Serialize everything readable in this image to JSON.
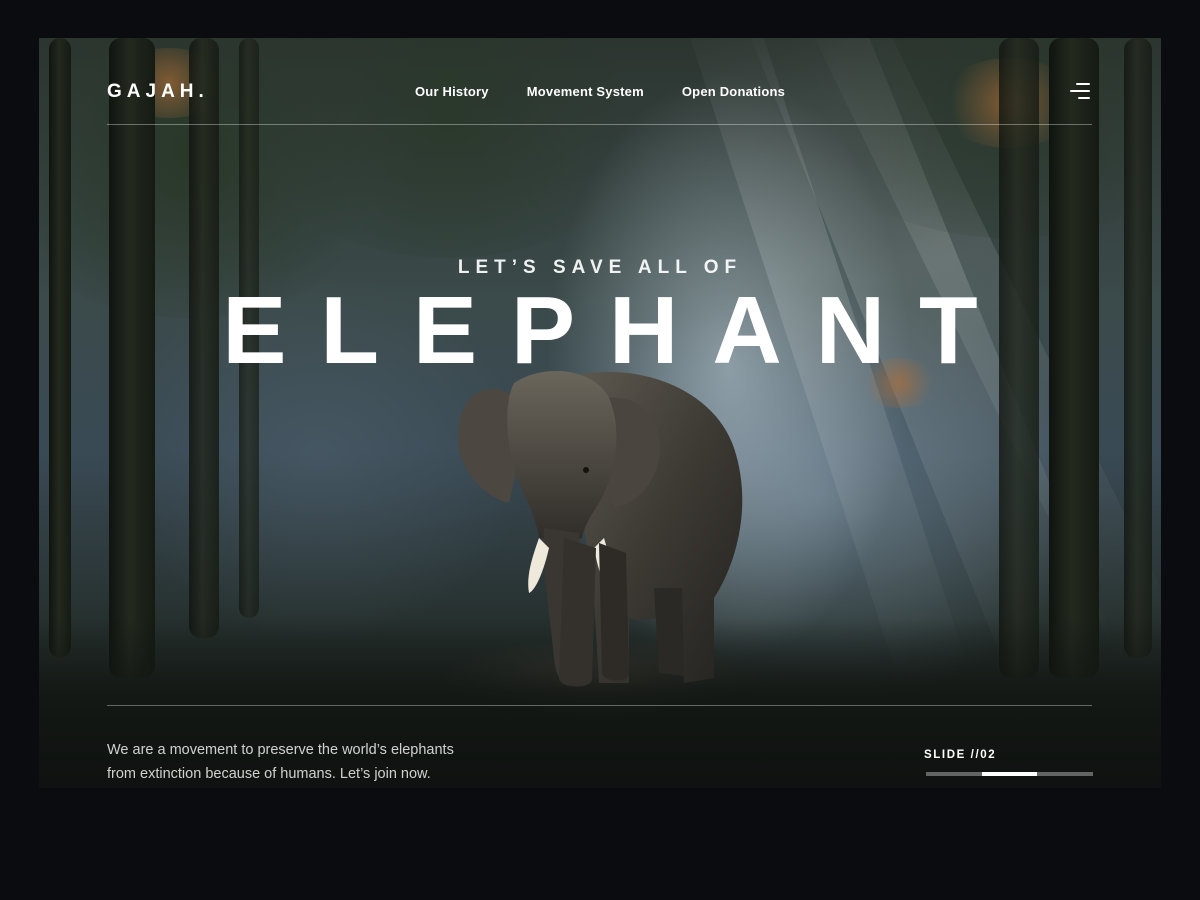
{
  "brand": {
    "logo": "GAJAH."
  },
  "nav": {
    "items": [
      {
        "label": "Our History"
      },
      {
        "label": "Movement System"
      },
      {
        "label": "Open Donations"
      }
    ],
    "menu_icon": "hamburger-menu-icon"
  },
  "hero": {
    "kicker": "LET’S SAVE ALL OF",
    "headline": "ELEPHANT"
  },
  "footer": {
    "description_line1": "We are a movement to preserve the world’s elephants",
    "description_line2": "from extinction because of humans. Let’s join now.",
    "slide_label": "SLIDE //02",
    "slide_current": 2,
    "slide_total": 3
  },
  "colors": {
    "page_background": "#0a0c0f",
    "text": "#ffffff"
  }
}
